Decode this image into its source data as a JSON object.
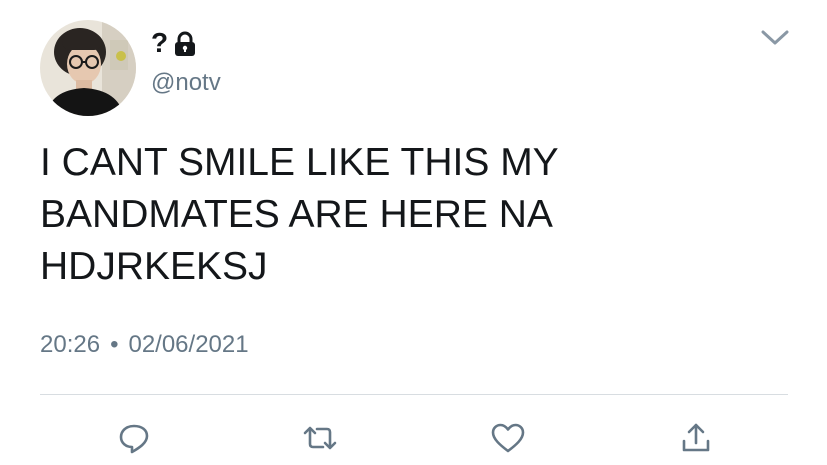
{
  "user": {
    "display_name": "?",
    "handle": "@notv",
    "avatar_icon": "avatar-photo",
    "protected_icon": "lock-icon"
  },
  "tweet": {
    "lines": [
      "I CANT SMILE LIKE THIS MY",
      "BANDMATES ARE HERE NA",
      "HDJRKEKSJ"
    ],
    "time": "20:26",
    "separator": "•",
    "date": "02/06/2021"
  },
  "actions": {
    "reply_icon": "reply-icon",
    "retweet_icon": "retweet-icon",
    "like_icon": "like-icon",
    "share_icon": "share-icon"
  },
  "menu": {
    "icon": "chevron-down-icon"
  },
  "colors": {
    "text_primary": "#14171a",
    "text_secondary": "#657786",
    "icon_gray": "#657786",
    "divider": "#d8dde1"
  }
}
